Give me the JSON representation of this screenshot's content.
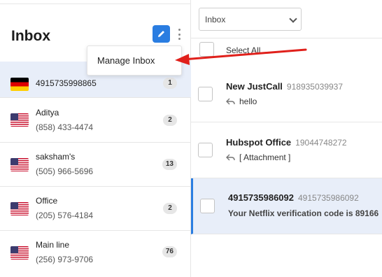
{
  "sidebar": {
    "title": "Inbox",
    "menu": {
      "manage_inbox": "Manage Inbox"
    },
    "numbers": [
      {
        "name": "",
        "phone": "4915735998865",
        "count": "1",
        "flag": "de-flag-icon"
      },
      {
        "name": "Aditya",
        "phone": "(858) 433-4474",
        "count": "2",
        "flag": "us-flag-icon"
      },
      {
        "name": "saksham's",
        "phone": "(505) 966-5696",
        "count": "13",
        "flag": "us-flag-icon"
      },
      {
        "name": "Office",
        "phone": "(205) 576-4184",
        "count": "2",
        "flag": "us-flag-icon"
      },
      {
        "name": "Main line",
        "phone": "(256) 973-9706",
        "count": "76",
        "flag": "us-flag-icon"
      }
    ]
  },
  "main": {
    "filter": {
      "value": "Inbox"
    },
    "select_all": "Select All",
    "messages": [
      {
        "name": "New JustCall",
        "number": "918935039937",
        "preview": "hello"
      },
      {
        "name": "Hubspot Office",
        "number": "19044748272",
        "preview": "[ Attachment ]"
      },
      {
        "name": "4915735986092",
        "number": "4915735986092",
        "preview": "Your Netflix verification code is 89166"
      }
    ]
  },
  "colors": {
    "accent": "#2a7de1",
    "selected_bg": "#e8eef9",
    "annotation_arrow": "#e0201b"
  }
}
